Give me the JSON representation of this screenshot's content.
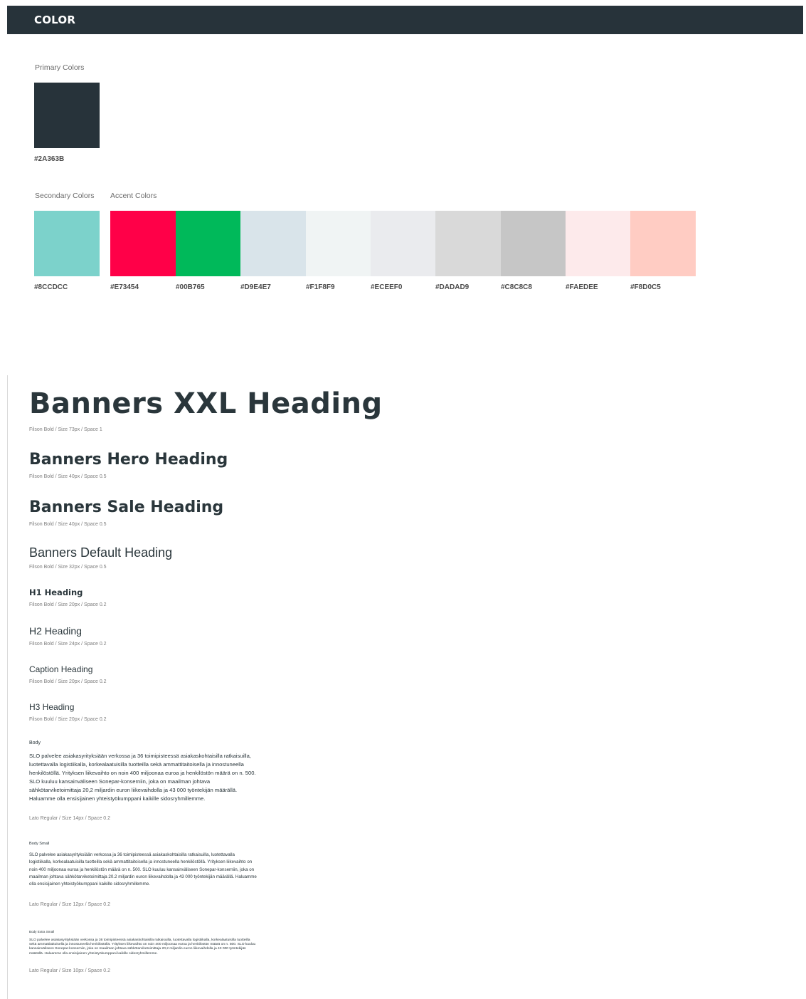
{
  "header": {
    "title": "COLOR"
  },
  "primary": {
    "label": "Primary Colors",
    "swatches": [
      {
        "hex": "#2A363B",
        "color": "#27333A"
      }
    ]
  },
  "secondary": {
    "label": "Secondary Colors",
    "swatches": [
      {
        "hex": "#8CCDCC",
        "color": "#7CD2CB"
      }
    ]
  },
  "accent": {
    "label": "Accent Colors",
    "swatches": [
      {
        "hex": "#E73454",
        "color": "#FF0048"
      },
      {
        "hex": "#00B765",
        "color": "#00B95A"
      },
      {
        "hex": "#D9E4E7",
        "color": "#D9E4EA"
      },
      {
        "hex": "#F1F8F9",
        "color": "#F0F4F4"
      },
      {
        "hex": "#ECEEF0",
        "color": "#EAEBEE"
      },
      {
        "hex": "#DADAD9",
        "color": "#D9D9D9"
      },
      {
        "hex": "#C8C8C8",
        "color": "#C6C6C6"
      },
      {
        "hex": "#FAEDEE",
        "color": "#FDEAEB"
      },
      {
        "hex": "#F8D0C5",
        "color": "#FFCCC3"
      }
    ]
  },
  "typography": {
    "headings": [
      {
        "text": "Banners XXL Heading",
        "spec": "Filson Bold / Size 73px / Space 1"
      },
      {
        "text": "Banners Hero Heading",
        "spec": "Filson Bold / Size 40px / Space 0.5"
      },
      {
        "text": "Banners Sale Heading",
        "spec": "Filson Bold / Size 40px / Space 0.5"
      },
      {
        "text": "Banners Default Heading",
        "spec": "Filson Bold / Size 32px / Space 0.5"
      },
      {
        "text": "H1 Heading",
        "spec": "Filson Bold / Size 20px / Space 0.2"
      },
      {
        "text": "H2 Heading",
        "spec": "Filson Bold / Size 24px / Space 0.2"
      },
      {
        "text": "Caption Heading",
        "spec": "Filson Bold / Size 20px / Space 0.2"
      },
      {
        "text": "H3 Heading",
        "spec": "Filson Bold / Size 20px / Space 0.2"
      }
    ],
    "body_sections": [
      {
        "title": "Body",
        "text": "SLO palvelee asiakasyrityksiään verkossa ja 36 toimipisteessä asiakaskohtaisilla ratkaisuilla, luotettavalla logistiikalla, korkealaatuisilla tuotteilla sekä ammattitaitoisella ja innostuneella henkilöstöllä. Yrityksen liikevaihto on noin 400 miljoonaa euroa ja henkilöstön määrä on n. 500. SLO kuuluu kansainväliseen Sonepar-konserniin, joka on maailman johtava sähkötarviketoimittaja 20,2 miljardin euron liikevaihdolla ja 43 000 työntekijän määrällä. Haluamme olla ensisijainen yhteistyökumppani kaikille sidosryhmillemme.",
        "spec": "Lato Regular / Size  14px / Space 0.2"
      },
      {
        "title": "Body Small",
        "text": "SLO palvelee asiakasyrityksiään verkossa ja 36 toimipisteessä asiakaskohtaisilla ratkaisuilla, luotettavalla logistiikalla, korkealaatuisilla tuotteilla sekä ammattitaitoisella ja innostuneella henkilöstöllä. Yrityksen liikevaihto on noin 400 miljoonaa euroa ja henkilöstön määrä on n. 500. SLO kuuluu kansainväliseen Sonepar-konserniin, joka on maailman johtava sähkötarviketoimittaja 20.2 miljardin euron liikevaihdolla ja 43 000 työntekijän määrällä. Haluamme olla ensisijainen yhteistyökumppani kaikille sidosryhmillemme.",
        "spec": "Lato Regular / Size  12px / Space 0.2"
      },
      {
        "title": "Body Extra Small",
        "text": "SLO palvelee asiakasyrityksiään verkossa ja 36 toimipisteessä asiakaskohtaisilla ratkaisuilla, luotettavalla logistiikalla, korkealaatuisilla tuotteilla sekä ammattitaitoisella ja innostuneella henkilöstöllä. Yrityksen liikevaihto on noin 400 miljoonaa euroa ja henkilöstön määrä on n. 500. SLO kuuluu kansainväliseen Sonepar-konserniin, joka on maailman johtava sähkötarviketoimittaja 20,2 miljardin euron liikevaihdolla ja 43 000 työntekijän määrällä. Haluamme olla ensisijainen yhteistyökumppani kaikille sidosryhmillemme.",
        "spec": "Lato Regular / Size  10px / Space 0.2"
      }
    ]
  }
}
